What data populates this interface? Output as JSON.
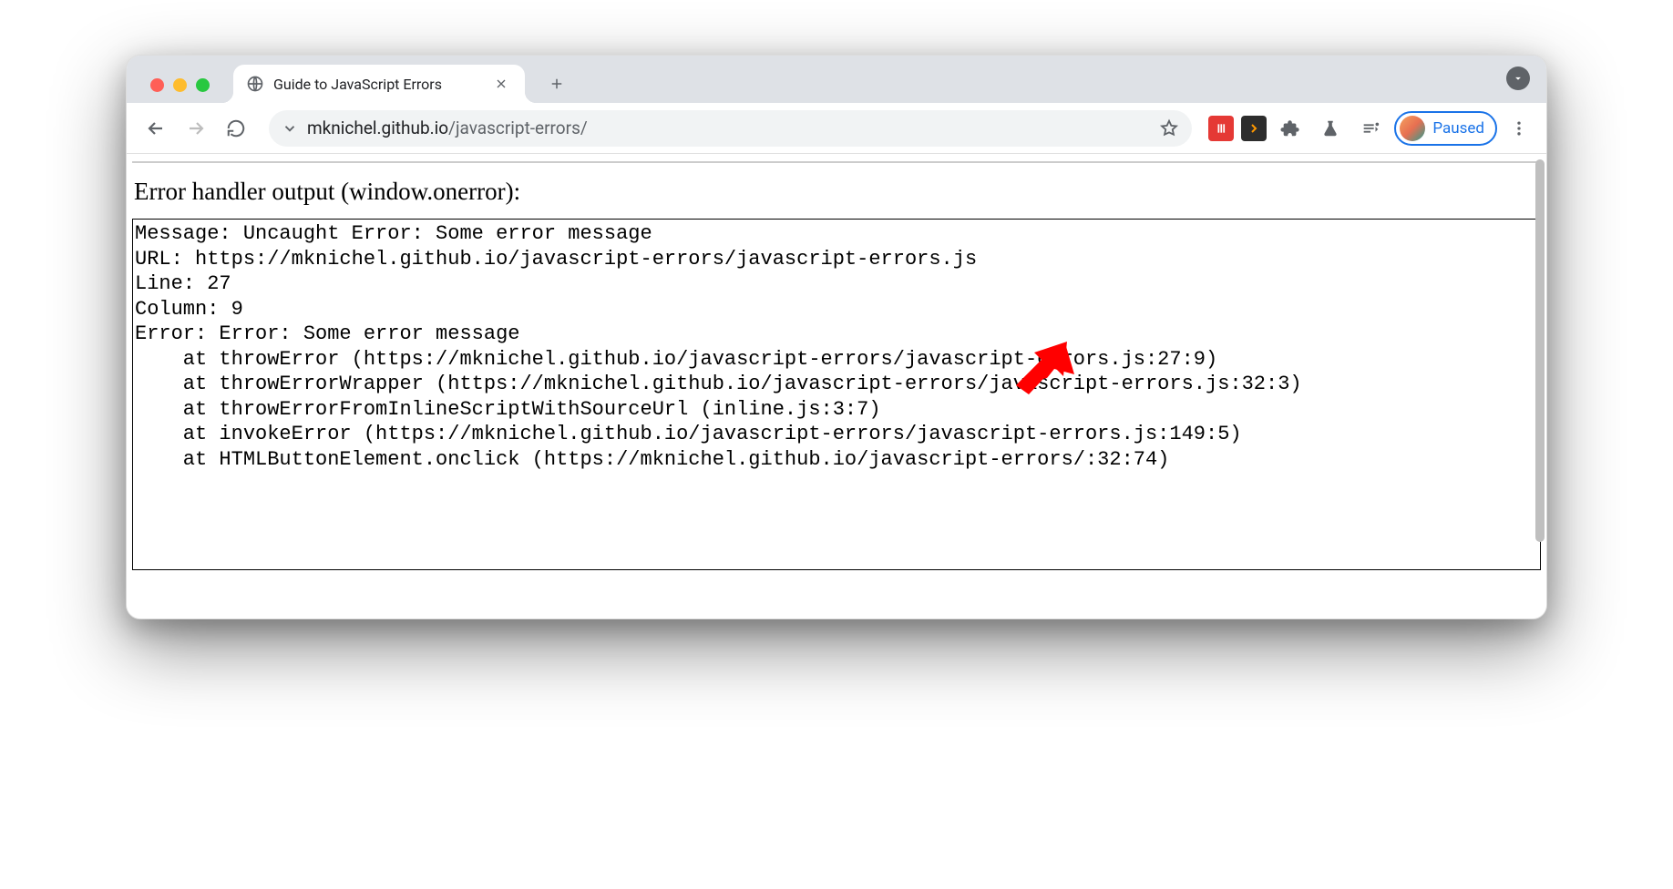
{
  "tab": {
    "title": "Guide to JavaScript Errors"
  },
  "url": {
    "domain": "mknichel.github.io",
    "path": "/javascript-errors/"
  },
  "profile": {
    "status": "Paused"
  },
  "page": {
    "heading": "Error handler output (window.onerror):",
    "output_lines": [
      "Message: Uncaught Error: Some error message",
      "URL: https://mknichel.github.io/javascript-errors/javascript-errors.js",
      "Line: 27",
      "Column: 9",
      "Error: Error: Some error message",
      "    at throwError (https://mknichel.github.io/javascript-errors/javascript-errors.js:27:9)",
      "    at throwErrorWrapper (https://mknichel.github.io/javascript-errors/javascript-errors.js:32:3)",
      "    at throwErrorFromInlineScriptWithSourceUrl (inline.js:3:7)",
      "    at invokeError (https://mknichel.github.io/javascript-errors/javascript-errors.js:149:5)",
      "    at HTMLButtonElement.onclick (https://mknichel.github.io/javascript-errors/:32:74)"
    ]
  }
}
